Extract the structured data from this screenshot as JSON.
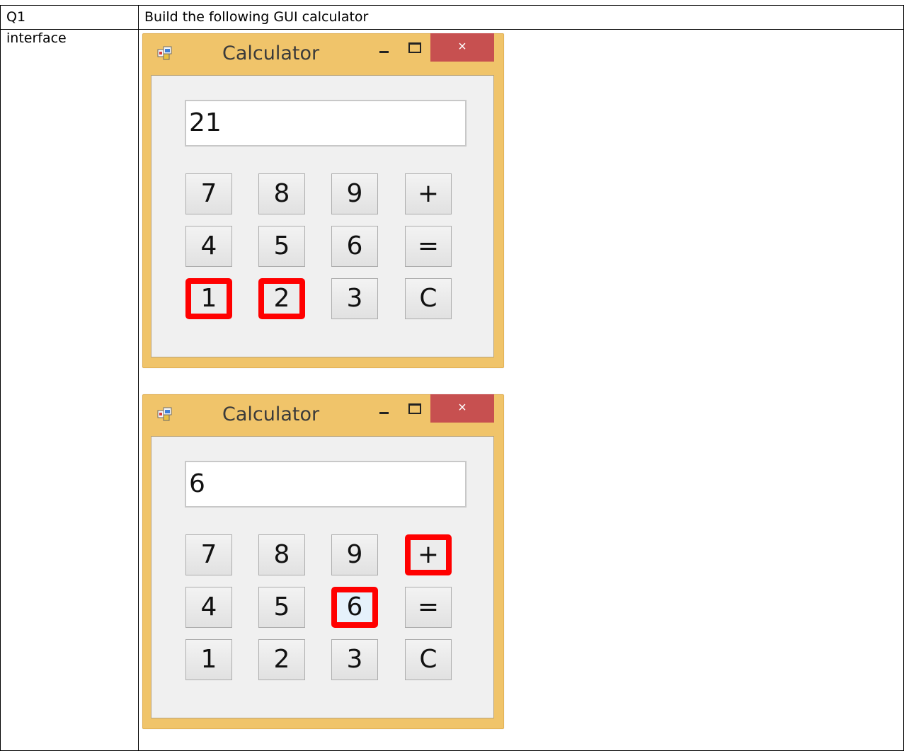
{
  "table": {
    "row1_label": "Q1",
    "row1_text": "Build the following GUI calculator",
    "row2_label": "interface"
  },
  "window_title": "Calculator",
  "close_glyph": "×",
  "calculators": [
    {
      "display": "21",
      "highlighted_buttons": [
        "1",
        "2"
      ]
    },
    {
      "display": "6",
      "highlighted_buttons": [
        "+",
        "6"
      ]
    }
  ],
  "buttons": [
    [
      "7",
      "8",
      "9",
      "+"
    ],
    [
      "4",
      "5",
      "6",
      "="
    ],
    [
      "1",
      "2",
      "3",
      "C"
    ]
  ],
  "colors": {
    "title_bar": "#f0c46a",
    "close_button": "#c75050",
    "highlight": "#ff0000",
    "client_area": "#f0f0f0"
  }
}
